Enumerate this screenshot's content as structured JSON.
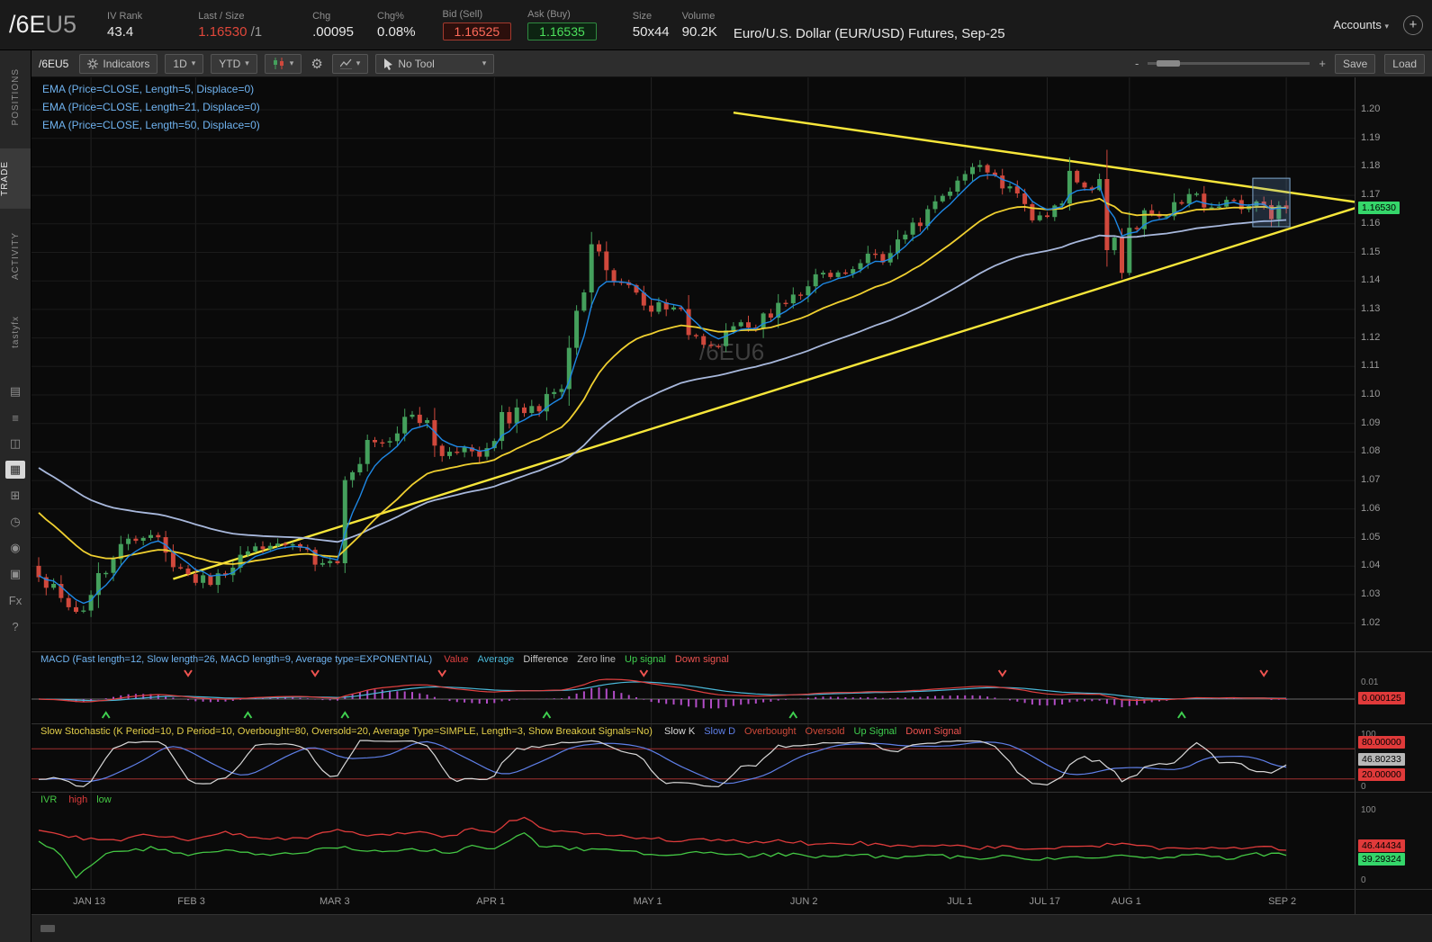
{
  "icons": {
    "dropdown_arrow": "▾",
    "gear": "⚙",
    "minus": "-",
    "plus": "+",
    "circle_plus": "+"
  },
  "header": {
    "symbol_main": "/6E",
    "symbol_suffix": "U5",
    "iv_rank_label": "IV Rank",
    "iv_rank": "43.4",
    "last_label": "Last / Size",
    "last": "1.16530",
    "last_suffix": "/1",
    "chg_label": "Chg",
    "chg": ".00095",
    "chg_pct_label": "Chg%",
    "chg_pct": "0.08%",
    "bid_label": "Bid (Sell)",
    "bid": "1.16525",
    "ask_label": "Ask (Buy)",
    "ask": "1.16535",
    "size_label": "Size",
    "size": "50x44",
    "volume_label": "Volume",
    "volume": "90.2K",
    "description": "Euro/U.S. Dollar (EUR/USD) Futures, Sep-25",
    "accounts_label": "Accounts"
  },
  "sidebar": {
    "tabs": [
      {
        "label": "POSITIONS",
        "active": false
      },
      {
        "label": "TRADE",
        "active": true
      },
      {
        "label": "ACTIVITY",
        "active": false
      },
      {
        "label": "tastyfx",
        "active": false
      }
    ],
    "icons": [
      {
        "name": "news-icon",
        "glyph": "▤",
        "active": false
      },
      {
        "name": "watchlist-icon",
        "glyph": "≡",
        "active": false
      },
      {
        "name": "analyze-icon",
        "glyph": "◫",
        "active": false
      },
      {
        "name": "chart-icon",
        "glyph": "▦",
        "active": true
      },
      {
        "name": "grid-icon",
        "glyph": "⊞",
        "active": false
      },
      {
        "name": "history-icon",
        "glyph": "◷",
        "active": false
      },
      {
        "name": "social-icon",
        "glyph": "◉",
        "active": false
      },
      {
        "name": "calendar-icon",
        "glyph": "▣",
        "active": false
      },
      {
        "name": "fx-icon",
        "glyph": "Fx",
        "active": false
      },
      {
        "name": "help-icon",
        "glyph": "?",
        "active": false
      }
    ]
  },
  "toolbar": {
    "symbol": "/6EU5",
    "indicators_label": "Indicators",
    "timeframe": "1D",
    "range": "YTD",
    "no_tool_label": "No Tool",
    "save_label": "Save",
    "load_label": "Load"
  },
  "chart": {
    "studies": [
      "EMA (Price=CLOSE, Length=5, Displace=0)",
      "EMA (Price=CLOSE, Length=21, Displace=0)",
      "EMA (Price=CLOSE, Length=50, Displace=0)"
    ],
    "watermark": "/6EU6",
    "price_axis": {
      "min": 1.02,
      "max": 1.2,
      "step": 0.01,
      "last": "1.16530"
    },
    "time_axis": [
      {
        "label": "JAN 13",
        "day": 7
      },
      {
        "label": "FEB 3",
        "day": 21
      },
      {
        "label": "MAR 3",
        "day": 40
      },
      {
        "label": "APR 1",
        "day": 61
      },
      {
        "label": "MAY 1",
        "day": 82
      },
      {
        "label": "JUN 2",
        "day": 103
      },
      {
        "label": "JUL 1",
        "day": 124
      },
      {
        "label": "JUL 17",
        "day": 135
      },
      {
        "label": "AUG 1",
        "day": 146
      },
      {
        "label": "SEP 2",
        "day": 167
      }
    ]
  },
  "panels": {
    "macd": {
      "title": "MACD (Fast length=12, Slow length=26, MACD length=9, Average type=EXPONENTIAL)",
      "legend": [
        {
          "text": "Value",
          "color": "#e04040"
        },
        {
          "text": "Average",
          "color": "#4ab8d8"
        },
        {
          "text": "Difference",
          "color": "#c8c8c8"
        },
        {
          "text": "Zero line",
          "color": "#b8b8b8"
        },
        {
          "text": "Up signal",
          "color": "#3fcf4f"
        },
        {
          "text": "Down signal",
          "color": "#ef5350"
        }
      ],
      "axis_label": "0.01",
      "badge": "0.000125"
    },
    "stoch": {
      "title": "Slow Stochastic (K Period=10, D Period=10, Overbought=80, Oversold=20, Average Type=SIMPLE, Length=3, Show Breakout Signals=No)",
      "legend": [
        {
          "text": "Slow K",
          "color": "#d8d8d8"
        },
        {
          "text": "Slow D",
          "color": "#5f7fe8"
        },
        {
          "text": "Overbought",
          "color": "#d04a3a"
        },
        {
          "text": "Oversold",
          "color": "#d04a3a"
        },
        {
          "text": "Up Signal",
          "color": "#3fcf4f"
        },
        {
          "text": "Down Signal",
          "color": "#ef5350"
        }
      ],
      "axis_top": "100",
      "axis_bottom": "0",
      "badges": {
        "overbought": "80.00000",
        "current": "46.80233",
        "oversold": "20.00000"
      }
    },
    "ivr": {
      "title": "IVR",
      "legend": [
        {
          "text": "high",
          "color": "#dd3b3b"
        },
        {
          "text": "low",
          "color": "#44c744"
        }
      ],
      "axis_top": "100",
      "axis_bottom": "0",
      "badges": {
        "high": "46.44434",
        "low": "39.29324"
      }
    }
  },
  "chart_data": {
    "type": "candlestick",
    "symbol": "/6EU5",
    "timeframe": "1D",
    "range": "YTD",
    "num_days": 168,
    "last_close": 1.1653,
    "price_anchors": [
      [
        0,
        1.036
      ],
      [
        2,
        1.031
      ],
      [
        5,
        1.025
      ],
      [
        7,
        1.03
      ],
      [
        10,
        1.043
      ],
      [
        13,
        1.05
      ],
      [
        15,
        1.052
      ],
      [
        18,
        1.043
      ],
      [
        21,
        1.036
      ],
      [
        23,
        1.033
      ],
      [
        26,
        1.041
      ],
      [
        29,
        1.045
      ],
      [
        32,
        1.047
      ],
      [
        35,
        1.048
      ],
      [
        38,
        1.04
      ],
      [
        40,
        1.046
      ],
      [
        41,
        1.063
      ],
      [
        42,
        1.073
      ],
      [
        43,
        1.08
      ],
      [
        45,
        1.084
      ],
      [
        47,
        1.087
      ],
      [
        49,
        1.094
      ],
      [
        51,
        1.091
      ],
      [
        53,
        1.083
      ],
      [
        55,
        1.079
      ],
      [
        57,
        1.081
      ],
      [
        59,
        1.079
      ],
      [
        61,
        1.082
      ],
      [
        63,
        1.095
      ],
      [
        64,
        1.098
      ],
      [
        65,
        1.092
      ],
      [
        67,
        1.096
      ],
      [
        69,
        1.104
      ],
      [
        70,
        1.11
      ],
      [
        71,
        1.122
      ],
      [
        72,
        1.131
      ],
      [
        73,
        1.138
      ],
      [
        74,
        1.152
      ],
      [
        75,
        1.146
      ],
      [
        76,
        1.142
      ],
      [
        78,
        1.138
      ],
      [
        80,
        1.136
      ],
      [
        82,
        1.131
      ],
      [
        84,
        1.132
      ],
      [
        86,
        1.127
      ],
      [
        88,
        1.121
      ],
      [
        90,
        1.117
      ],
      [
        92,
        1.12
      ],
      [
        94,
        1.124
      ],
      [
        96,
        1.122
      ],
      [
        98,
        1.128
      ],
      [
        100,
        1.134
      ],
      [
        102,
        1.136
      ],
      [
        103,
        1.138
      ],
      [
        105,
        1.142
      ],
      [
        107,
        1.141
      ],
      [
        109,
        1.146
      ],
      [
        111,
        1.15
      ],
      [
        113,
        1.147
      ],
      [
        115,
        1.152
      ],
      [
        117,
        1.158
      ],
      [
        119,
        1.163
      ],
      [
        121,
        1.171
      ],
      [
        123,
        1.177
      ],
      [
        125,
        1.181
      ],
      [
        126,
        1.179
      ],
      [
        128,
        1.177
      ],
      [
        130,
        1.172
      ],
      [
        132,
        1.168
      ],
      [
        134,
        1.162
      ],
      [
        136,
        1.167
      ],
      [
        138,
        1.178
      ],
      [
        140,
        1.175
      ],
      [
        142,
        1.169
      ],
      [
        143,
        1.158
      ],
      [
        144,
        1.147
      ],
      [
        145,
        1.142
      ],
      [
        146,
        1.157
      ],
      [
        147,
        1.16
      ],
      [
        149,
        1.164
      ],
      [
        151,
        1.161
      ],
      [
        153,
        1.167
      ],
      [
        155,
        1.17
      ],
      [
        157,
        1.165
      ],
      [
        159,
        1.168
      ],
      [
        161,
        1.164
      ],
      [
        163,
        1.167
      ],
      [
        165,
        1.163
      ],
      [
        166,
        1.166
      ],
      [
        167,
        1.1653
      ]
    ],
    "ema_lengths": [
      5,
      21,
      50
    ],
    "ema_seeds": {
      "5": 1.037,
      "21": 1.061,
      "50": 1.076
    },
    "trendlines": [
      {
        "from": [
          93,
          1.199
        ],
        "to": [
          178,
          1.167
        ]
      },
      {
        "from": [
          18,
          1.0355
        ],
        "to": [
          178,
          1.167
        ]
      }
    ],
    "selection_box": {
      "from_day": 163,
      "to_day": 167,
      "top": 1.176,
      "bottom": 1.159
    },
    "macd_params": {
      "fast": 12,
      "slow": 26,
      "signal": 9
    },
    "stoch_params": {
      "k_period": 10,
      "d_period": 10,
      "smooth": 3,
      "overbought": 80,
      "oversold": 20
    },
    "ivr": {
      "high_anchors": [
        [
          0,
          70
        ],
        [
          5,
          62
        ],
        [
          10,
          58
        ],
        [
          15,
          66
        ],
        [
          20,
          60
        ],
        [
          25,
          68
        ],
        [
          30,
          62
        ],
        [
          35,
          60
        ],
        [
          40,
          72
        ],
        [
          45,
          65
        ],
        [
          50,
          70
        ],
        [
          55,
          63
        ],
        [
          58,
          75
        ],
        [
          61,
          70
        ],
        [
          63,
          83
        ],
        [
          65,
          88
        ],
        [
          67,
          75
        ],
        [
          70,
          70
        ],
        [
          75,
          65
        ],
        [
          80,
          62
        ],
        [
          85,
          58
        ],
        [
          90,
          60
        ],
        [
          95,
          55
        ],
        [
          100,
          58
        ],
        [
          105,
          52
        ],
        [
          110,
          55
        ],
        [
          115,
          50
        ],
        [
          120,
          52
        ],
        [
          125,
          48
        ],
        [
          130,
          50
        ],
        [
          135,
          46
        ],
        [
          140,
          50
        ],
        [
          145,
          54
        ],
        [
          150,
          48
        ],
        [
          155,
          50
        ],
        [
          160,
          47
        ],
        [
          163,
          52
        ],
        [
          167,
          46.4
        ]
      ],
      "low_anchors": [
        [
          0,
          55
        ],
        [
          3,
          40
        ],
        [
          5,
          10
        ],
        [
          8,
          35
        ],
        [
          10,
          42
        ],
        [
          15,
          48
        ],
        [
          20,
          40
        ],
        [
          25,
          45
        ],
        [
          30,
          40
        ],
        [
          35,
          42
        ],
        [
          40,
          50
        ],
        [
          45,
          44
        ],
        [
          50,
          48
        ],
        [
          55,
          42
        ],
        [
          58,
          50
        ],
        [
          61,
          46
        ],
        [
          63,
          60
        ],
        [
          65,
          68
        ],
        [
          67,
          52
        ],
        [
          70,
          48
        ],
        [
          75,
          45
        ],
        [
          80,
          42
        ],
        [
          85,
          40
        ],
        [
          90,
          42
        ],
        [
          95,
          38
        ],
        [
          100,
          40
        ],
        [
          105,
          36
        ],
        [
          110,
          39
        ],
        [
          115,
          35
        ],
        [
          120,
          38
        ],
        [
          125,
          34
        ],
        [
          130,
          37
        ],
        [
          135,
          33
        ],
        [
          140,
          36
        ],
        [
          145,
          40
        ],
        [
          150,
          35
        ],
        [
          155,
          38
        ],
        [
          160,
          34
        ],
        [
          163,
          40
        ],
        [
          167,
          39.3
        ]
      ]
    },
    "colors": {
      "up": "#44a05c",
      "down": "#d0483c",
      "ema5": "#1e88e5",
      "ema21": "#f0d030",
      "ema50": "#a8b8dc",
      "trendline": "#f7e63a",
      "macd_hist": "#b14cc6",
      "macd_value": "#e04040",
      "macd_avg": "#4ab8d8",
      "stoch_k": "#d8d8d8",
      "stoch_d": "#5f7fe8",
      "stoch_level": "#a03030",
      "ivr_high": "#dd3b3b",
      "ivr_low": "#44c744",
      "up_signal": "#3fcf4f",
      "down_signal": "#ef5350"
    }
  }
}
